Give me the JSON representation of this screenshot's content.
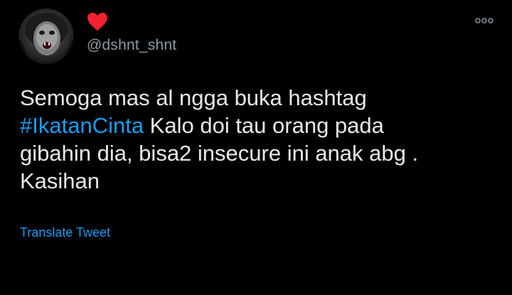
{
  "tweet": {
    "avatar_icon": "profile-avatar",
    "name_icon": "red-heart-icon",
    "handle": "@dshnt_shnt",
    "more_icon": "more-dots-icon",
    "text": {
      "line1": "Semoga mas al ngga buka hashtag",
      "line2_hashtag": "#IkatanCinta",
      "line2_rest": " Kalo doi tau orang pada",
      "line3": "gibahin dia, bisa2 insecure ini anak abg .",
      "line4": "Kasihan"
    },
    "translate_label": "Translate Tweet"
  },
  "colors": {
    "background": "#000000",
    "text": "#e7e9ea",
    "secondary": "#8b98a5",
    "accent": "#1d9bf0",
    "heart": "#f91880"
  }
}
